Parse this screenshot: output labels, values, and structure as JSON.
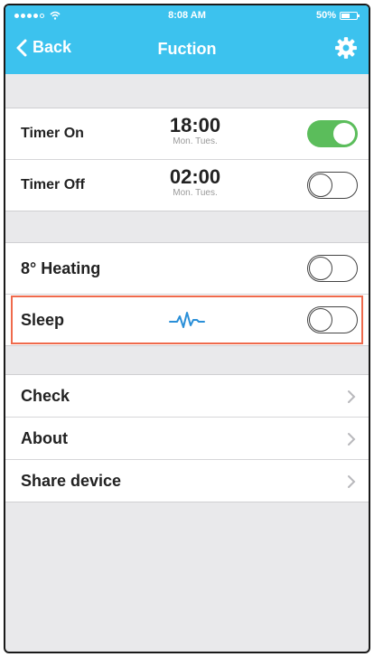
{
  "status": {
    "time": "8:08 AM",
    "battery": "50%"
  },
  "nav": {
    "back": "Back",
    "title": "Fuction"
  },
  "timers": [
    {
      "label": "Timer On",
      "time": "18:00",
      "days": "Mon. Tues.",
      "enabled": true
    },
    {
      "label": "Timer Off",
      "time": "02:00",
      "days": "Mon. Tues.",
      "enabled": false
    }
  ],
  "functions": {
    "heating": {
      "label": "8° Heating",
      "enabled": false
    },
    "sleep": {
      "label": "Sleep",
      "enabled": false,
      "icon": "sleep-wave-icon"
    }
  },
  "menu": [
    {
      "label": "Check"
    },
    {
      "label": "About"
    },
    {
      "label": "Share device"
    }
  ],
  "colors": {
    "header": "#3cc2ee",
    "toggle_on": "#5bbd5b",
    "highlight": "#ef6a4c",
    "wave": "#2a8fd8"
  }
}
